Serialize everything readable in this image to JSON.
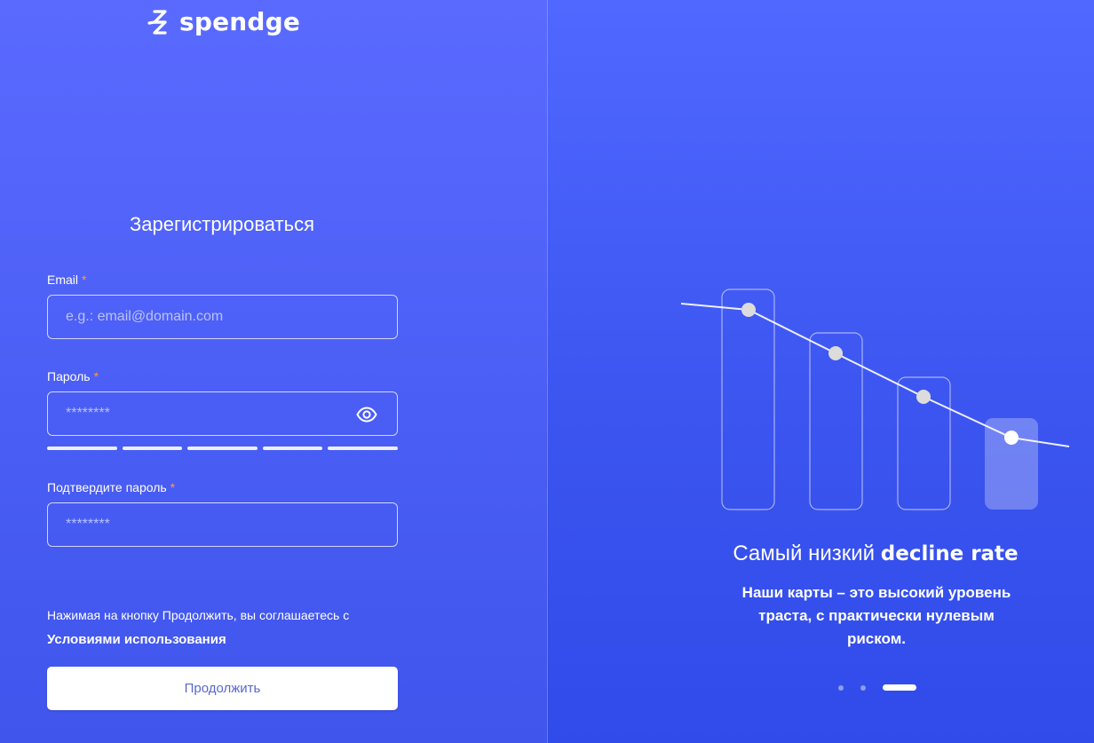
{
  "brand": {
    "name": "spendge",
    "logo_icon": "spendge-logo-icon"
  },
  "form": {
    "title": "Зарегистрироваться",
    "email": {
      "label": "Email",
      "required_mark": "*",
      "placeholder": "e.g.: email@domain.com",
      "value": ""
    },
    "password": {
      "label": "Пароль",
      "required_mark": "*",
      "placeholder": "********",
      "value": "",
      "toggle_icon": "eye-icon",
      "strength_segments": 5,
      "strength_filled": 5
    },
    "confirm_password": {
      "label": "Подтвердите пароль",
      "required_mark": "*",
      "placeholder": "********",
      "value": ""
    },
    "terms": {
      "text": "Нажимая на кнопку Продолжить, вы соглашаетесь с",
      "link": "Условиями использования"
    },
    "submit_label": "Продолжить"
  },
  "promo": {
    "title_prefix": "Самый низкий",
    "title_highlight": "decline rate",
    "text": "Наши карты – это высокий уровень траста, с практически нулевым риском.",
    "carousel": {
      "slides": 3,
      "active": 3
    }
  },
  "colors": {
    "accent": "#4a5ef5",
    "required": "#ff9a4a",
    "button_text": "#5a67cf"
  }
}
